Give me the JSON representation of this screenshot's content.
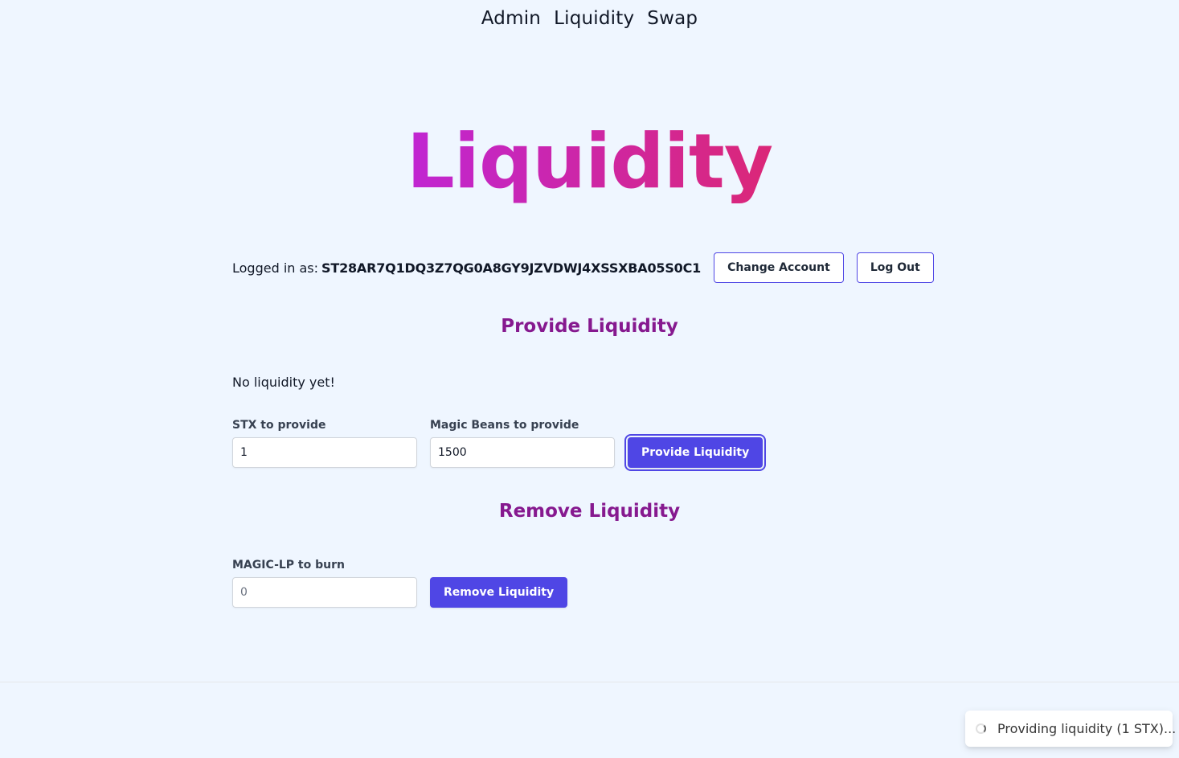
{
  "nav": {
    "items": [
      "Admin",
      "Liquidity",
      "Swap"
    ]
  },
  "hero": {
    "title": "Liquidity"
  },
  "account": {
    "label": "Logged in as:",
    "address": "ST28AR7Q1DQ3Z7QG0A8GY9JZVDWJ4XSSXBA05S0C1",
    "change_button": "Change Account",
    "logout_button": "Log Out"
  },
  "provide": {
    "title": "Provide Liquidity",
    "status": "No liquidity yet!",
    "stx_label": "STX to provide",
    "stx_value": "1",
    "beans_label": "Magic Beans to provide",
    "beans_value": "1500",
    "button": "Provide Liquidity"
  },
  "remove": {
    "title": "Remove Liquidity",
    "lp_label": "MAGIC-LP to burn",
    "lp_placeholder": "0",
    "button": "Remove Liquidity"
  },
  "toast": {
    "icon": "loading-spinner-icon",
    "message": "Providing liquidity (1 STX)..."
  },
  "colors": {
    "background": "#eff6ff",
    "accent": "#4f46e5",
    "heading": "#86198f",
    "hero_gradient_start": "#c026d3",
    "hero_gradient_end": "#db2777"
  }
}
